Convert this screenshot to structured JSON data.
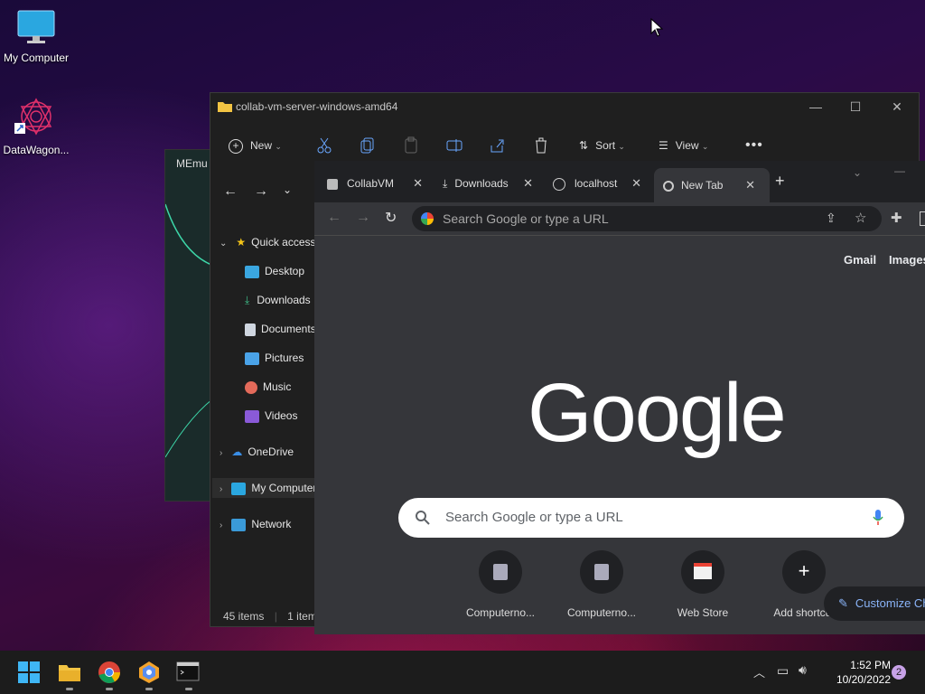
{
  "desktop": {
    "icons": [
      {
        "label": "My Computer",
        "icon": "monitor-icon"
      },
      {
        "label": "DataWagon...",
        "icon": "datawagon-icon"
      }
    ]
  },
  "memu": {
    "title": "MEmu"
  },
  "explorer": {
    "title": "collab-vm-server-windows-amd64",
    "toolbar": {
      "new": "New",
      "sort": "Sort",
      "view": "View"
    },
    "nav": {
      "quick_access": "Quick access",
      "items": [
        "Desktop",
        "Downloads",
        "Documents",
        "Pictures",
        "Music",
        "Videos"
      ],
      "onedrive": "OneDrive",
      "my_computer": "My Computer",
      "network": "Network"
    },
    "status": {
      "items": "45 items",
      "selected": "1 item"
    }
  },
  "chrome": {
    "tabs": [
      {
        "label": "CollabVM",
        "icon": "collabvm-icon"
      },
      {
        "label": "Downloads",
        "icon": "download-icon"
      },
      {
        "label": "localhost",
        "icon": "globe-icon"
      },
      {
        "label": "New Tab",
        "icon": "chrome-icon"
      }
    ],
    "omnibox_placeholder": "Search Google or type a URL",
    "links": {
      "gmail": "Gmail",
      "images": "Images"
    },
    "logo": "Google",
    "search_placeholder": "Search Google or type a URL",
    "shortcuts": [
      {
        "label": "Computerno..."
      },
      {
        "label": "Computerno..."
      },
      {
        "label": "Web Store"
      },
      {
        "label": "Add shortcut"
      }
    ],
    "customize": "Customize Chrome"
  },
  "taskbar": {
    "time": "1:52 PM",
    "date": "10/20/2022",
    "notifications": "2"
  },
  "colors": {
    "accent": "#8ab4f8",
    "taskbar": "#1c1c1c",
    "chrome_bg": "#35363a"
  }
}
